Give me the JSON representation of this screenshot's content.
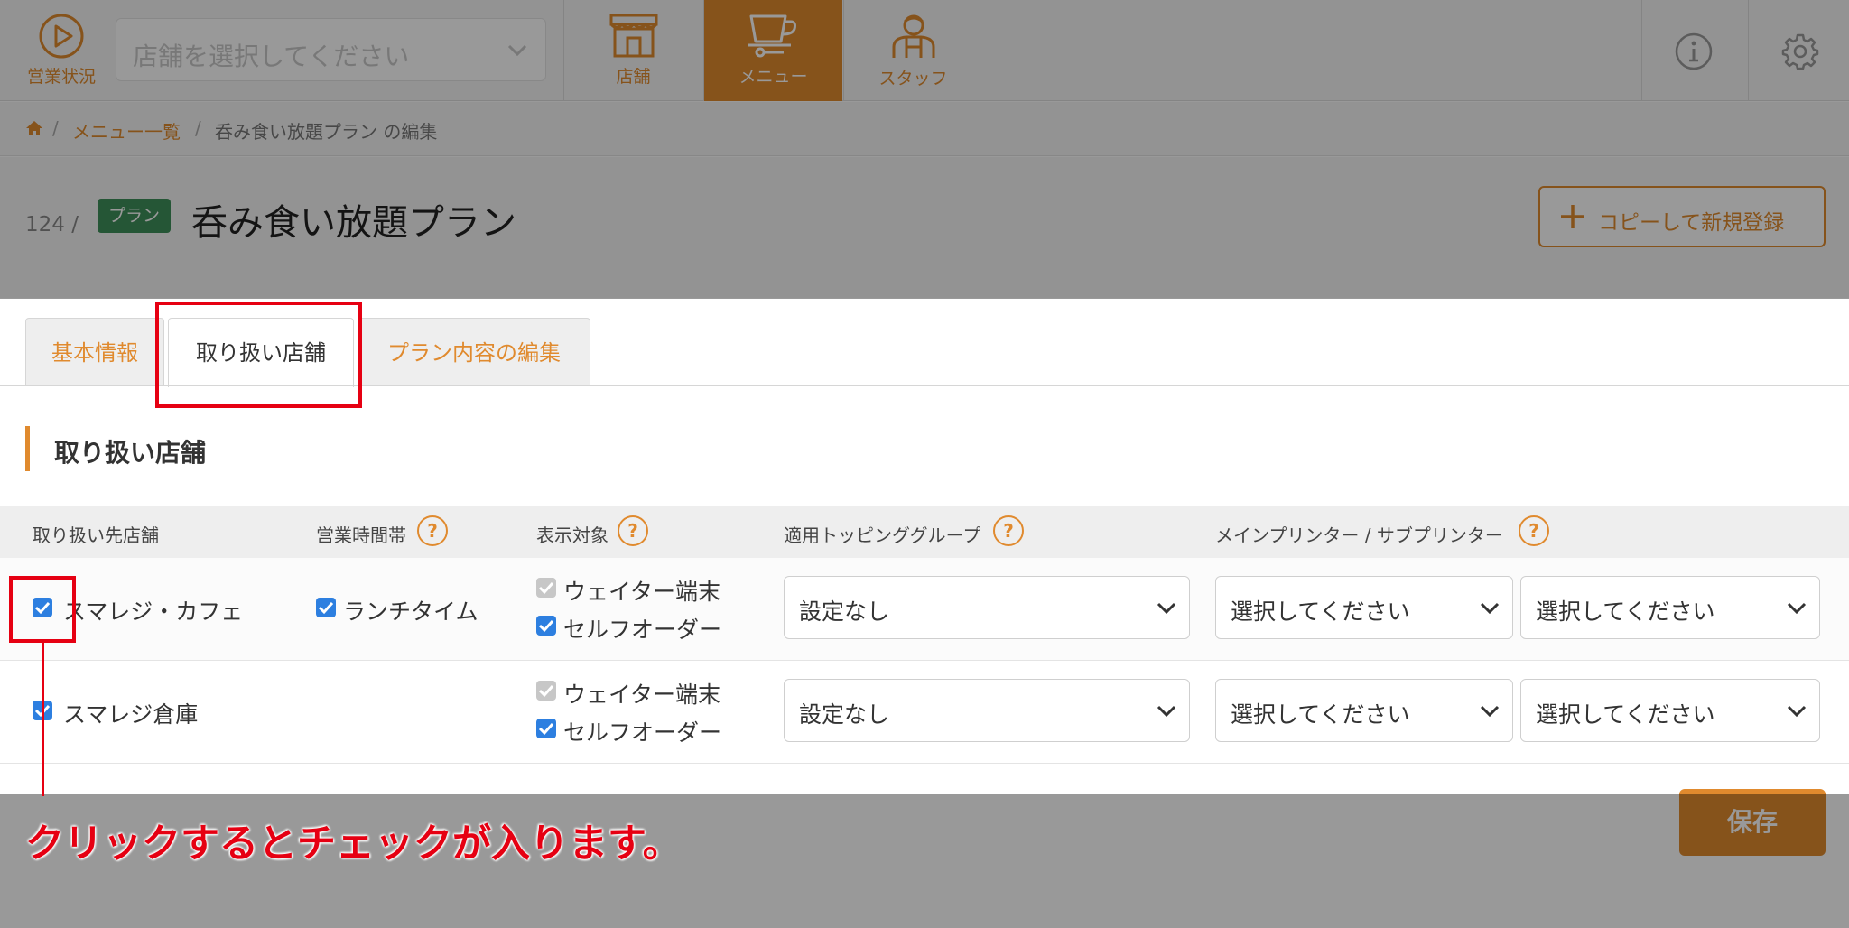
{
  "header": {
    "status_label": "営業状況",
    "store_select_placeholder": "店舗を選択してください",
    "nav": [
      {
        "label": "店舗"
      },
      {
        "label": "メニュー"
      },
      {
        "label": "スタッフ"
      }
    ],
    "accent_color": "#e08a2e"
  },
  "breadcrumb": {
    "items": [
      "メニュー一覧",
      "呑み食い放題プラン の編集"
    ]
  },
  "page": {
    "id": "124 /",
    "badge": "プラン",
    "title": "呑み食い放題プラン",
    "copy_button": "コピーして新規登録"
  },
  "tabs": [
    {
      "label": "基本情報"
    },
    {
      "label": "取り扱い店舗"
    },
    {
      "label": "プラン内容の編集"
    }
  ],
  "section": {
    "title": "取り扱い店舗"
  },
  "table": {
    "columns": [
      "取り扱い先店舗",
      "営業時間帯",
      "表示対象",
      "適用トッピンググループ",
      "メインプリンター / サブプリンター"
    ],
    "help_glyph": "?",
    "rows": [
      {
        "store": "スマレジ・カフェ",
        "store_checked": true,
        "time": "ランチタイム",
        "time_checked": true,
        "targets": [
          "ウェイター端末",
          "セルフオーダー"
        ],
        "topping": "設定なし",
        "main_printer": "選択してください",
        "sub_printer": "選択してください"
      },
      {
        "store": "スマレジ倉庫",
        "store_checked": true,
        "time": "",
        "targets": [
          "ウェイター端末",
          "セルフオーダー"
        ],
        "topping": "設定なし",
        "main_printer": "選択してください",
        "sub_printer": "選択してください"
      }
    ]
  },
  "save_button": "保存",
  "annotation": {
    "text": "クリックするとチェックが入ります。",
    "color": "#e60012"
  }
}
